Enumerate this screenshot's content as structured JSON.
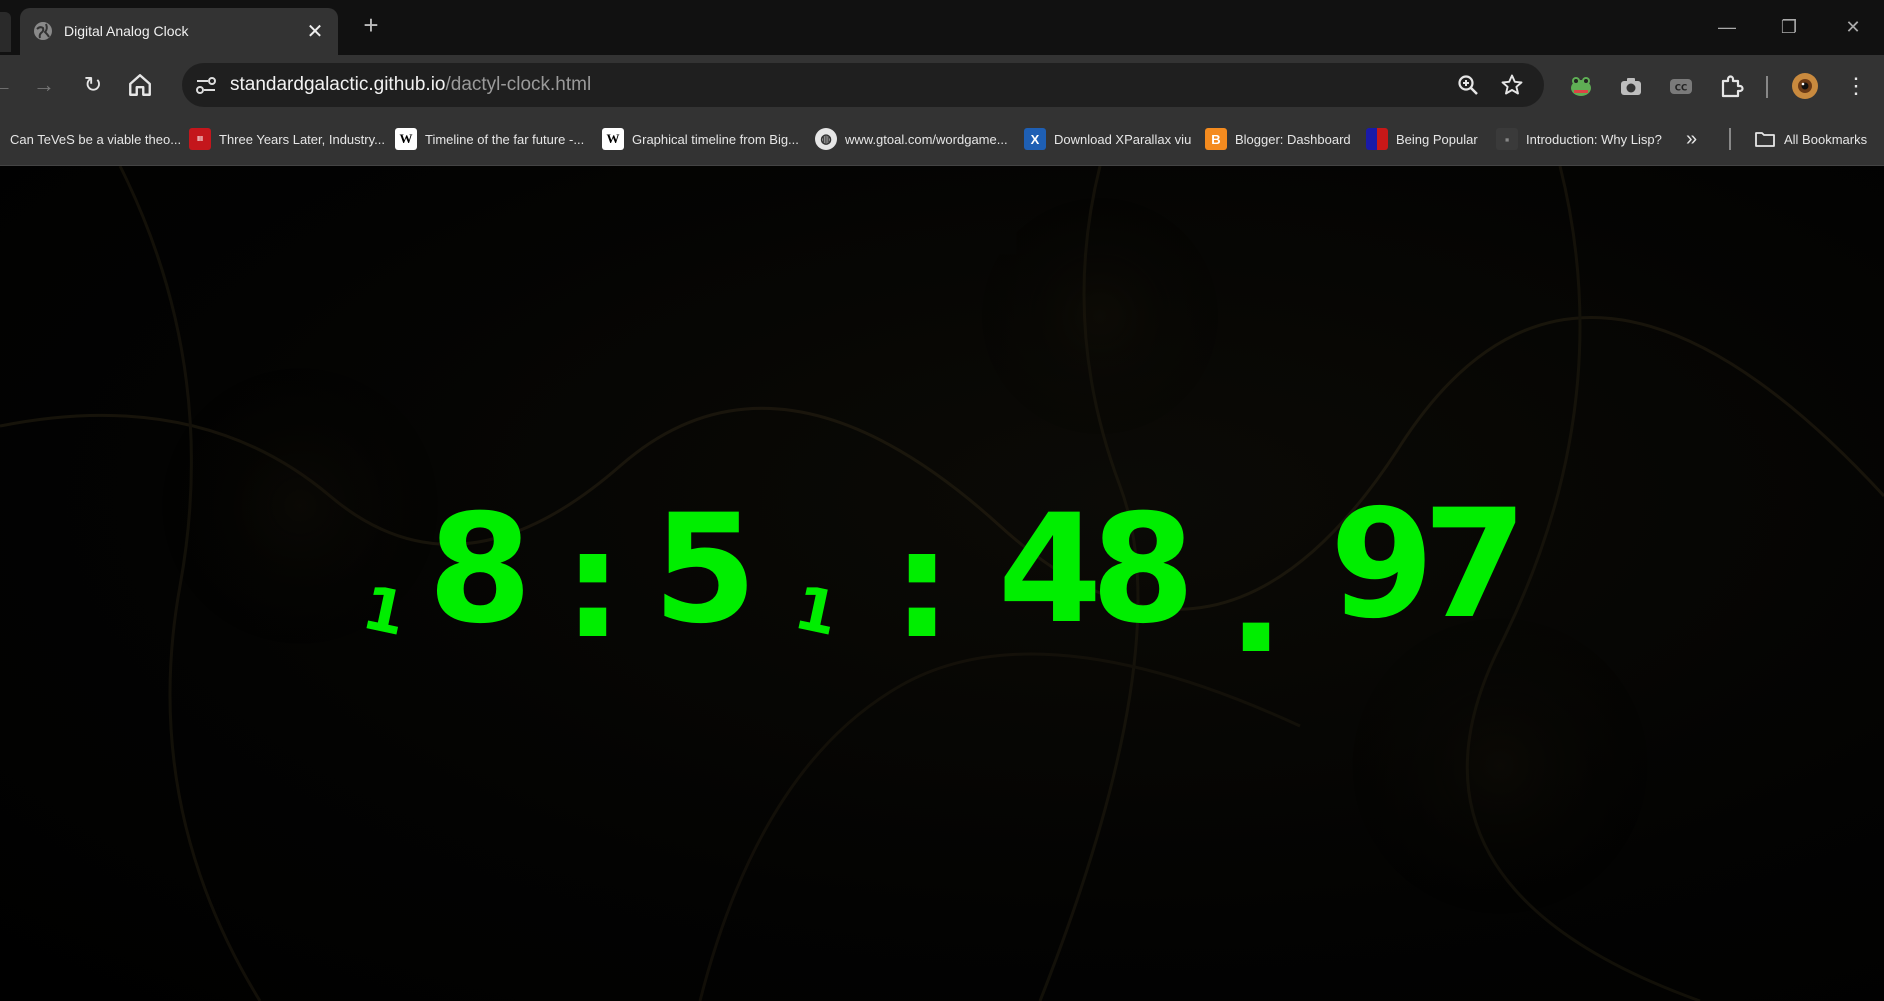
{
  "browser": {
    "tab": {
      "title": "Digital Analog Clock",
      "favicon": "globe-icon",
      "close_icon": "close-icon"
    },
    "new_tab_icon": "plus-icon",
    "window_controls": [
      "minimize-icon",
      "restore-icon",
      "close-icon"
    ],
    "toolbar": {
      "back_icon": "back-arrow-icon",
      "forward_icon": "forward-arrow-icon",
      "reload_icon": "reload-icon",
      "home_icon": "home-icon",
      "url_host": "standardgalactic.github.io",
      "url_path": "/dactyl-clock.html",
      "zoom_icon": "zoom-icon",
      "bookmark_star_icon": "star-icon",
      "extensions": [
        "frog-extension-icon",
        "camera-extension-icon",
        "cc-extension-icon",
        "puzzle-extensions-icon"
      ],
      "profile_icon": "profile-avatar",
      "menu_icon": "kebab-menu-icon"
    },
    "bookmarks": [
      {
        "label": "Can TeVeS be a viable theo...",
        "icon": "none"
      },
      {
        "label": "Three Years Later, Industry...",
        "icon": "red-site-icon"
      },
      {
        "label": "Timeline of the far future -...",
        "icon": "wikipedia-icon"
      },
      {
        "label": "Graphical timeline from Big...",
        "icon": "wikipedia-icon"
      },
      {
        "label": "www.gtoal.com/wordgame...",
        "icon": "globe-icon"
      },
      {
        "label": "Download XParallax viu",
        "icon": "xparallax-icon"
      },
      {
        "label": "Blogger: Dashboard",
        "icon": "blogger-icon"
      },
      {
        "label": "Being Popular",
        "icon": "paulgraham-icon"
      },
      {
        "label": "Introduction: Why Lisp?",
        "icon": "lisp-icon"
      }
    ],
    "bookmarks_overflow_icon": "chevron-double-right-icon",
    "all_bookmarks_label": "All Bookmarks"
  },
  "clock": {
    "glyphs": [
      "1",
      "8",
      ":",
      "5",
      "1",
      ":",
      "4",
      "8",
      ".",
      "9",
      "7"
    ],
    "color": "#00ee00",
    "background": "#000000"
  }
}
